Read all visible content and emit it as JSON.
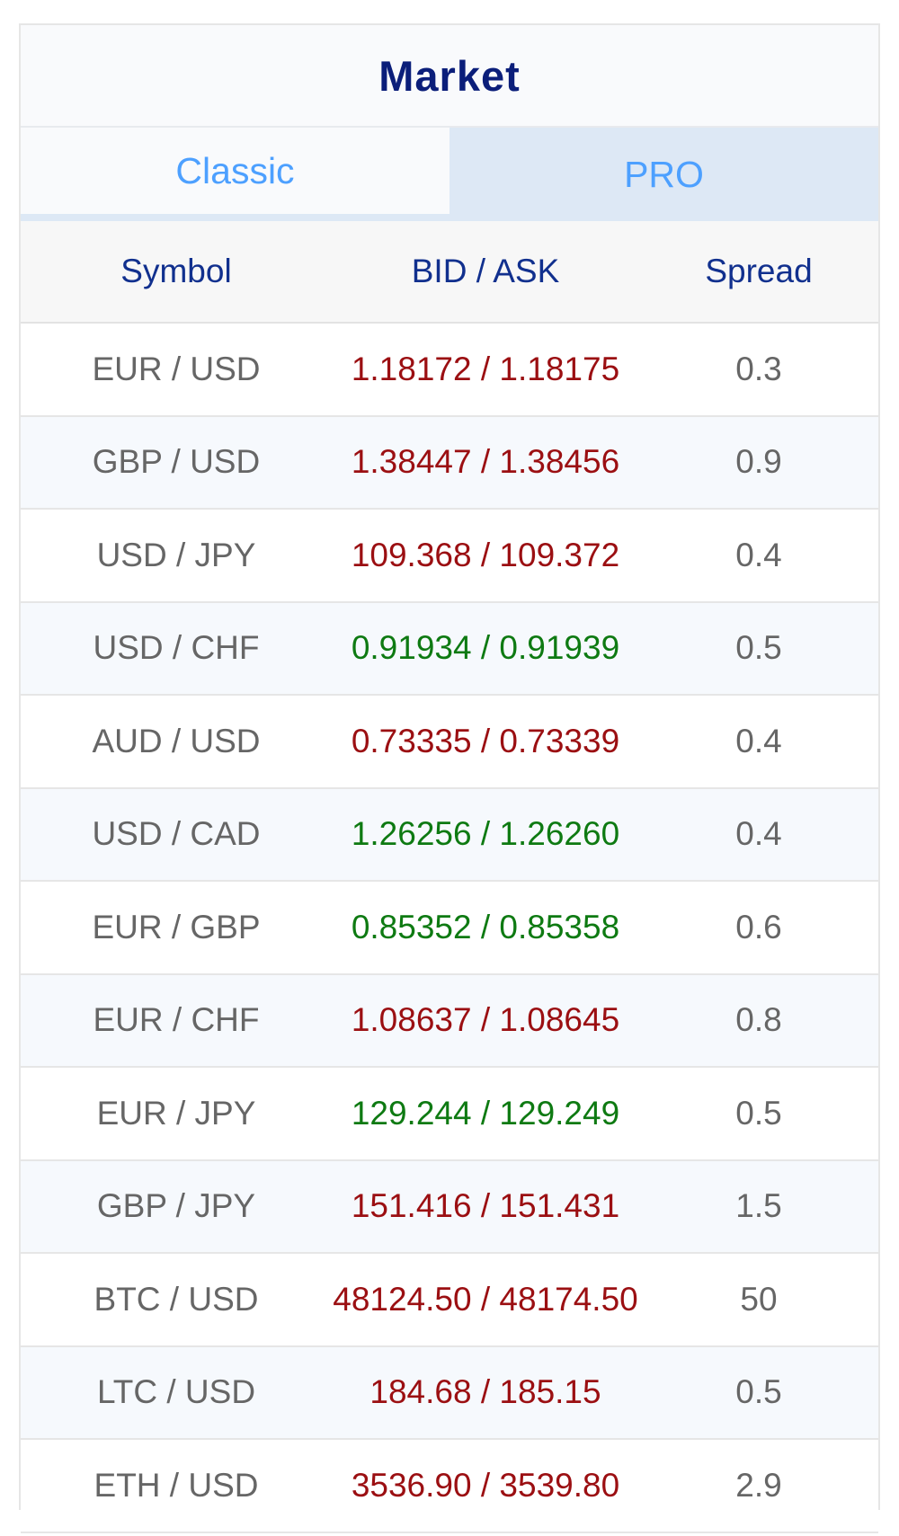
{
  "widget": {
    "title": "Market",
    "tabs": [
      {
        "label": "Classic",
        "active": true
      },
      {
        "label": "PRO",
        "active": false
      }
    ],
    "columns": {
      "symbol": "Symbol",
      "bid_ask": "BID / ASK",
      "spread": "Spread"
    },
    "separator": " / ",
    "colors": {
      "title": "#0b1e7a",
      "tab_text": "#4da0ff",
      "price_red": "#9b0f12",
      "price_green": "#0e7a12"
    },
    "rows": [
      {
        "symbol": "EUR / USD",
        "bid": "1.18172",
        "ask": "1.18175",
        "spread": "0.3",
        "color": "red"
      },
      {
        "symbol": "GBP / USD",
        "bid": "1.38447",
        "ask": "1.38456",
        "spread": "0.9",
        "color": "red"
      },
      {
        "symbol": "USD / JPY",
        "bid": "109.368",
        "ask": "109.372",
        "spread": "0.4",
        "color": "red"
      },
      {
        "symbol": "USD / CHF",
        "bid": "0.91934",
        "ask": "0.91939",
        "spread": "0.5",
        "color": "green"
      },
      {
        "symbol": "AUD / USD",
        "bid": "0.73335",
        "ask": "0.73339",
        "spread": "0.4",
        "color": "red"
      },
      {
        "symbol": "USD / CAD",
        "bid": "1.26256",
        "ask": "1.26260",
        "spread": "0.4",
        "color": "green"
      },
      {
        "symbol": "EUR / GBP",
        "bid": "0.85352",
        "ask": "0.85358",
        "spread": "0.6",
        "color": "green"
      },
      {
        "symbol": "EUR / CHF",
        "bid": "1.08637",
        "ask": "1.08645",
        "spread": "0.8",
        "color": "red"
      },
      {
        "symbol": "EUR / JPY",
        "bid": "129.244",
        "ask": "129.249",
        "spread": "0.5",
        "color": "green"
      },
      {
        "symbol": "GBP / JPY",
        "bid": "151.416",
        "ask": "151.431",
        "spread": "1.5",
        "color": "red"
      },
      {
        "symbol": "BTC / USD",
        "bid": "48124.50",
        "ask": "48174.50",
        "spread": "50",
        "color": "red"
      },
      {
        "symbol": "LTC / USD",
        "bid": "184.68",
        "ask": "185.15",
        "spread": "0.5",
        "color": "red"
      },
      {
        "symbol": "ETH / USD",
        "bid": "3536.90",
        "ask": "3539.80",
        "spread": "2.9",
        "color": "red"
      }
    ]
  }
}
